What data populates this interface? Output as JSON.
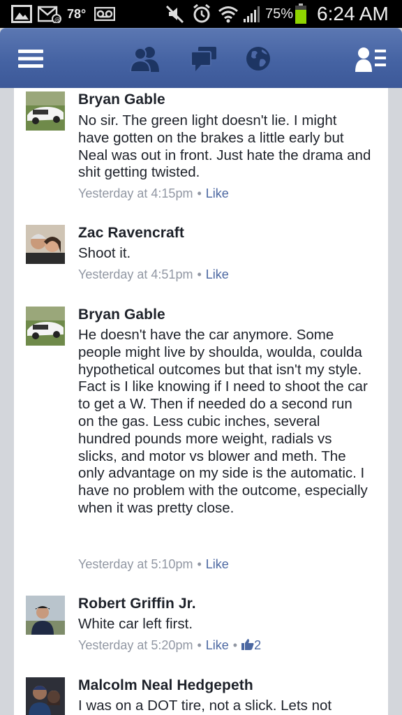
{
  "status_bar": {
    "temperature": "78°",
    "battery_percent": "75%",
    "time": "6:24 AM",
    "left_icons": [
      "image-icon",
      "mail-check-icon",
      "voicemail-icon"
    ],
    "right_icons": [
      "mute-icon",
      "alarm-icon",
      "wifi-icon",
      "signal-icon",
      "battery-icon"
    ],
    "battery_level": 0.75
  },
  "navbar": {
    "icons": [
      "menu-icon",
      "friend-requests-icon",
      "messages-icon",
      "notifications-globe-icon",
      "chat-contacts-icon"
    ]
  },
  "comments": [
    {
      "author": "Bryan Gable",
      "text": "No sir. The green light doesn't lie. I might have gotten on the brakes a little early but Neal was out in front. Just hate the drama and shit getting twisted.",
      "time": "Yesterday at 4:15pm",
      "like_label": "Like",
      "like_count": ""
    },
    {
      "author": "Zac Ravencraft",
      "text": "Shoot it.",
      "time": "Yesterday at 4:51pm",
      "like_label": "Like",
      "like_count": ""
    },
    {
      "author": "Bryan Gable",
      "text": "He doesn't have the car anymore. Some people might live by shoulda, woulda, coulda hypothetical outcomes but that isn't my style. Fact is I like knowing if I need to shoot the car to get a W. Then if needed do a second run on the gas. Less cubic inches, several hundred pounds more weight, radials vs slicks, and motor vs blower and meth. The only advantage on my side is the automatic. I have no problem with the outcome, especially when it was pretty close.",
      "time": "Yesterday at 5:10pm",
      "like_label": "Like",
      "like_count": ""
    },
    {
      "author": "Robert Griffin Jr.",
      "text": "White car left first.",
      "time": "Yesterday at 5:20pm",
      "like_label": "Like",
      "like_count": "2"
    },
    {
      "author": "Malcolm Neal Hedgepeth",
      "text": "I was on a DOT tire, not a slick. Lets not",
      "time": "",
      "like_label": "",
      "like_count": ""
    }
  ],
  "colors": {
    "navbar": "#4563a3",
    "link": "#4b67a1",
    "meta_gray": "#9197a3",
    "battery_green": "#8fd400"
  }
}
